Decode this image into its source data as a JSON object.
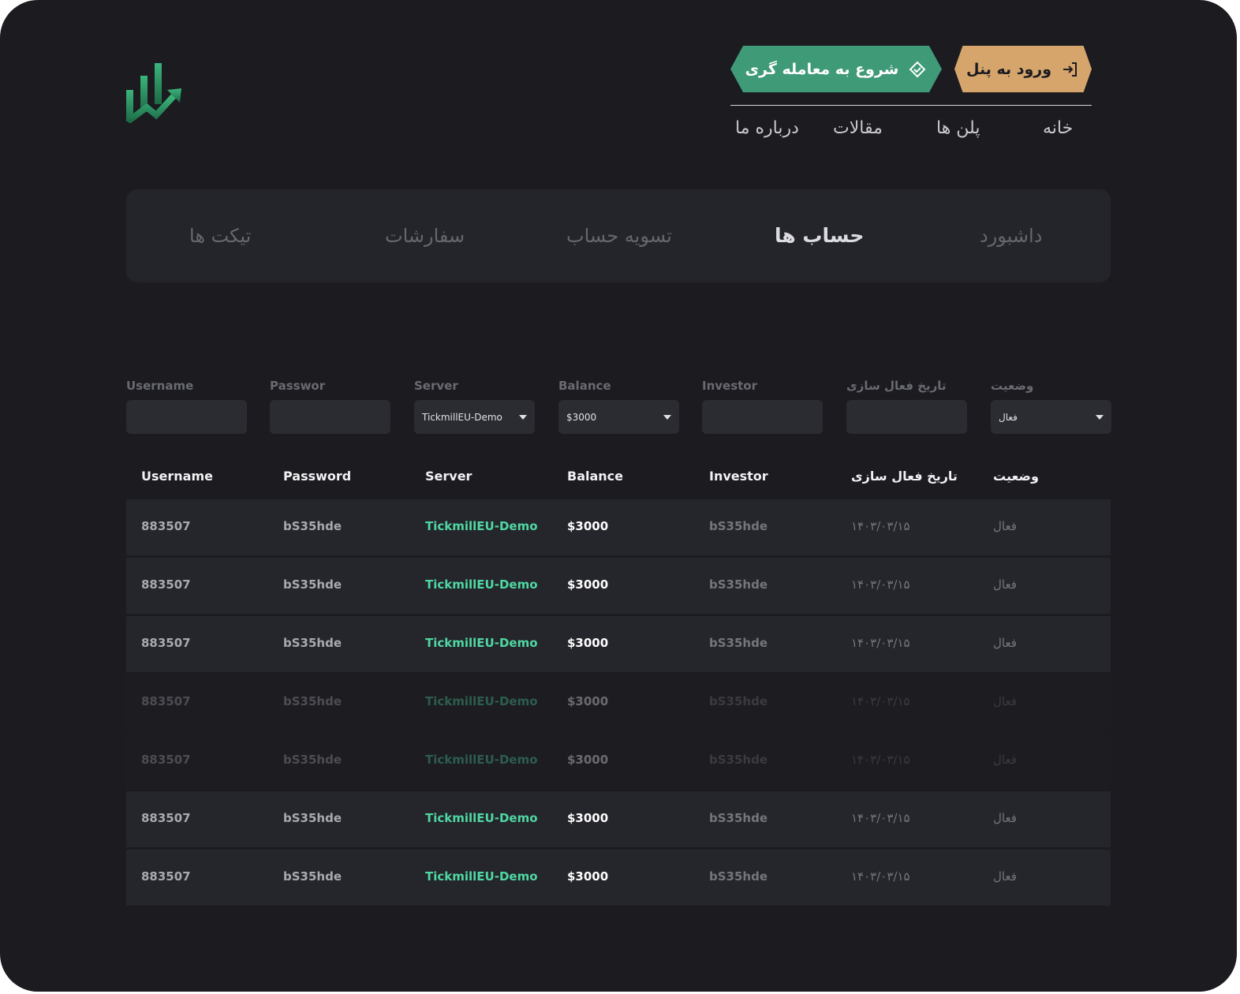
{
  "header": {
    "login_button": "ورود به پنل",
    "trade_button": "شروع به معامله گری",
    "nav": [
      "خانه",
      "پلن ها",
      "مقالات",
      "درباره ما"
    ]
  },
  "tabs": [
    {
      "label": "داشبورد",
      "active": false
    },
    {
      "label": "حساب ها",
      "active": true
    },
    {
      "label": "تسویه حساب",
      "active": false
    },
    {
      "label": "سفارشات",
      "active": false
    },
    {
      "label": "تیکت ها",
      "active": false
    }
  ],
  "filters": {
    "username_label": "Username",
    "username_value": "",
    "password_label": "Passwor",
    "password_value": "",
    "server_label": "Server",
    "server_value": "TickmillEU-Demo",
    "balance_label": "Balance",
    "balance_value": "$3000",
    "investor_label": "Investor",
    "investor_value": "",
    "date_label": "تاریخ فعال سازی",
    "date_value": "",
    "status_label": "وضعیت",
    "status_value": "فعال"
  },
  "table": {
    "headers": [
      "Username",
      "Password",
      "Server",
      "Balance",
      "Investor",
      "تاریخ فعال سازی",
      "وضعیت"
    ],
    "rows": [
      {
        "username": "883507",
        "password": "bS35hde",
        "server": "TickmillEU-Demo",
        "balance": "$3000",
        "investor": "bS35hde",
        "date": "۱۴۰۳/۰۳/۱۵",
        "status": "فعال"
      },
      {
        "username": "883507",
        "password": "bS35hde",
        "server": "TickmillEU-Demo",
        "balance": "$3000",
        "investor": "bS35hde",
        "date": "۱۴۰۳/۰۳/۱۵",
        "status": "فعال"
      },
      {
        "username": "883507",
        "password": "bS35hde",
        "server": "TickmillEU-Demo",
        "balance": "$3000",
        "investor": "bS35hde",
        "date": "۱۴۰۳/۰۳/۱۵",
        "status": "فعال"
      },
      {
        "username": "883507",
        "password": "bS35hde",
        "server": "TickmillEU-Demo",
        "balance": "$3000",
        "investor": "bS35hde",
        "date": "۱۴۰۳/۰۳/۱۵",
        "status": "فعال"
      },
      {
        "username": "883507",
        "password": "bS35hde",
        "server": "TickmillEU-Demo",
        "balance": "$3000",
        "investor": "bS35hde",
        "date": "۱۴۰۳/۰۳/۱۵",
        "status": "فعال"
      },
      {
        "username": "883507",
        "password": "bS35hde",
        "server": "TickmillEU-Demo",
        "balance": "$3000",
        "investor": "bS35hde",
        "date": "۱۴۰۳/۰۳/۱۵",
        "status": "فعال"
      },
      {
        "username": "883507",
        "password": "bS35hde",
        "server": "TickmillEU-Demo",
        "balance": "$3000",
        "investor": "bS35hde",
        "date": "۱۴۰۳/۰۳/۱۵",
        "status": "فعال"
      }
    ]
  },
  "colors": {
    "background": "#1b1b20",
    "login_button": "#d6a56c",
    "trade_button": "#3f9a78",
    "server_text": "#4fd8a2",
    "logo": "#2e9a68"
  },
  "icons": {
    "logo": "bar-chart-logo",
    "login": "login-icon",
    "trade": "handshake-icon"
  }
}
